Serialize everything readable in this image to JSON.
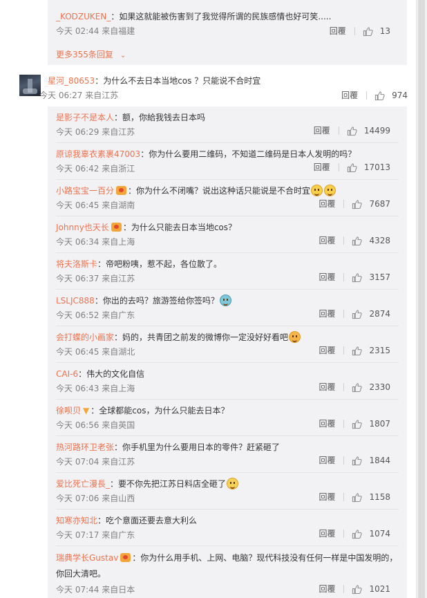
{
  "previous": {
    "reply": {
      "author": "_KODZUKEN_",
      "text": "如果这就能被伤害到了我觉得所谓的民族感情也好可笑.....",
      "meta": "今天 02:44 来自福建",
      "reply_label": "回覆",
      "likes": "13"
    },
    "more_label": "更多355条回复"
  },
  "main": {
    "author": "星河_80653",
    "text": "为什么不去日本当地cos ？只能说不合时宜",
    "meta": "今天 06:27 来自江苏",
    "reply_label": "回覆",
    "likes": "974"
  },
  "replies": [
    {
      "author": "是影子不是本人",
      "text": "额，你給我钱去日本吗",
      "meta": "今天 06:29 来自江苏",
      "reply_label": "回覆",
      "likes": "14499"
    },
    {
      "author": "原谅我辜衣素裹47003",
      "text": "你为什么要用二维码，不知道二维码是日本人发明的吗？",
      "meta": "今天 06:42 来自浙江",
      "reply_label": "回覆",
      "likes": "17013"
    },
    {
      "author": "小路宝宝一百分",
      "text": "你为什么不闭嘴？说出这种话只能说是不合时宜",
      "meta": "今天 06:45 来自湖南",
      "reply_label": "回覆",
      "likes": "7687"
    },
    {
      "author": "Johnny也天长",
      "text": "为什么只能去日本当地cos？",
      "meta": "今天 06:34 来自上海",
      "reply_label": "回覆",
      "likes": "4328"
    },
    {
      "author": "将夫洛斯卡",
      "text": "帝吧粉咦，惹不起，各位散了。",
      "meta": "今天 06:37 来自江苏",
      "reply_label": "回覆",
      "likes": "3157"
    },
    {
      "author": "LSLJC888",
      "text": "你出的去吗？旅游签给你签吗？",
      "meta": "今天 06:52 来自广东",
      "reply_label": "回覆",
      "likes": "2874"
    },
    {
      "author": "会打蝶的小画家",
      "text": "妈的，共青团之前发的微博你一定没好好看吧",
      "meta": "今天 06:45 来自湖北",
      "reply_label": "回覆",
      "likes": "2315"
    },
    {
      "author": "CAI-6",
      "text": "伟大的文化自信",
      "meta": "今天 06:43 来自上海",
      "reply_label": "回覆",
      "likes": "2330"
    },
    {
      "author": "徐呗贝",
      "text": "全球都能cos，为什么只能去日本？",
      "meta": "今天 06:56 来自英国",
      "reply_label": "回覆",
      "likes": "1807"
    },
    {
      "author": "热河路环卫老张",
      "text": "你手机里为什么要用日本的零件？赶紧砸了",
      "meta": "今天 07:04 来自江苏",
      "reply_label": "回覆",
      "likes": "1844"
    },
    {
      "author": "爱比死亡漫長_",
      "text": "要不你先把江苏日料店全砸了",
      "meta": "今天 07:06 来自山西",
      "reply_label": "回覆",
      "likes": "1158"
    },
    {
      "author": "知寒亦知北",
      "text": "吃个意面还要去意大利么",
      "meta": "今天 07:17 来自广东",
      "reply_label": "回覆",
      "likes": "1074"
    },
    {
      "author": "瑞典学长Gustav",
      "text": "你为什么用手机、上网、电脑？现代科技没有任何一样是中国发明的，你回大清吧。",
      "meta": "今天 07:44 来自日本",
      "reply_label": "回覆",
      "likes": "1021"
    }
  ],
  "icons": {
    "like": "thumbs-up-icon",
    "more": "chevron-down-icon",
    "badge": "vip-badge-icon"
  },
  "colors": {
    "author": "#eb7350",
    "reply_bg": "#f2f2f5",
    "meta": "#808080"
  }
}
